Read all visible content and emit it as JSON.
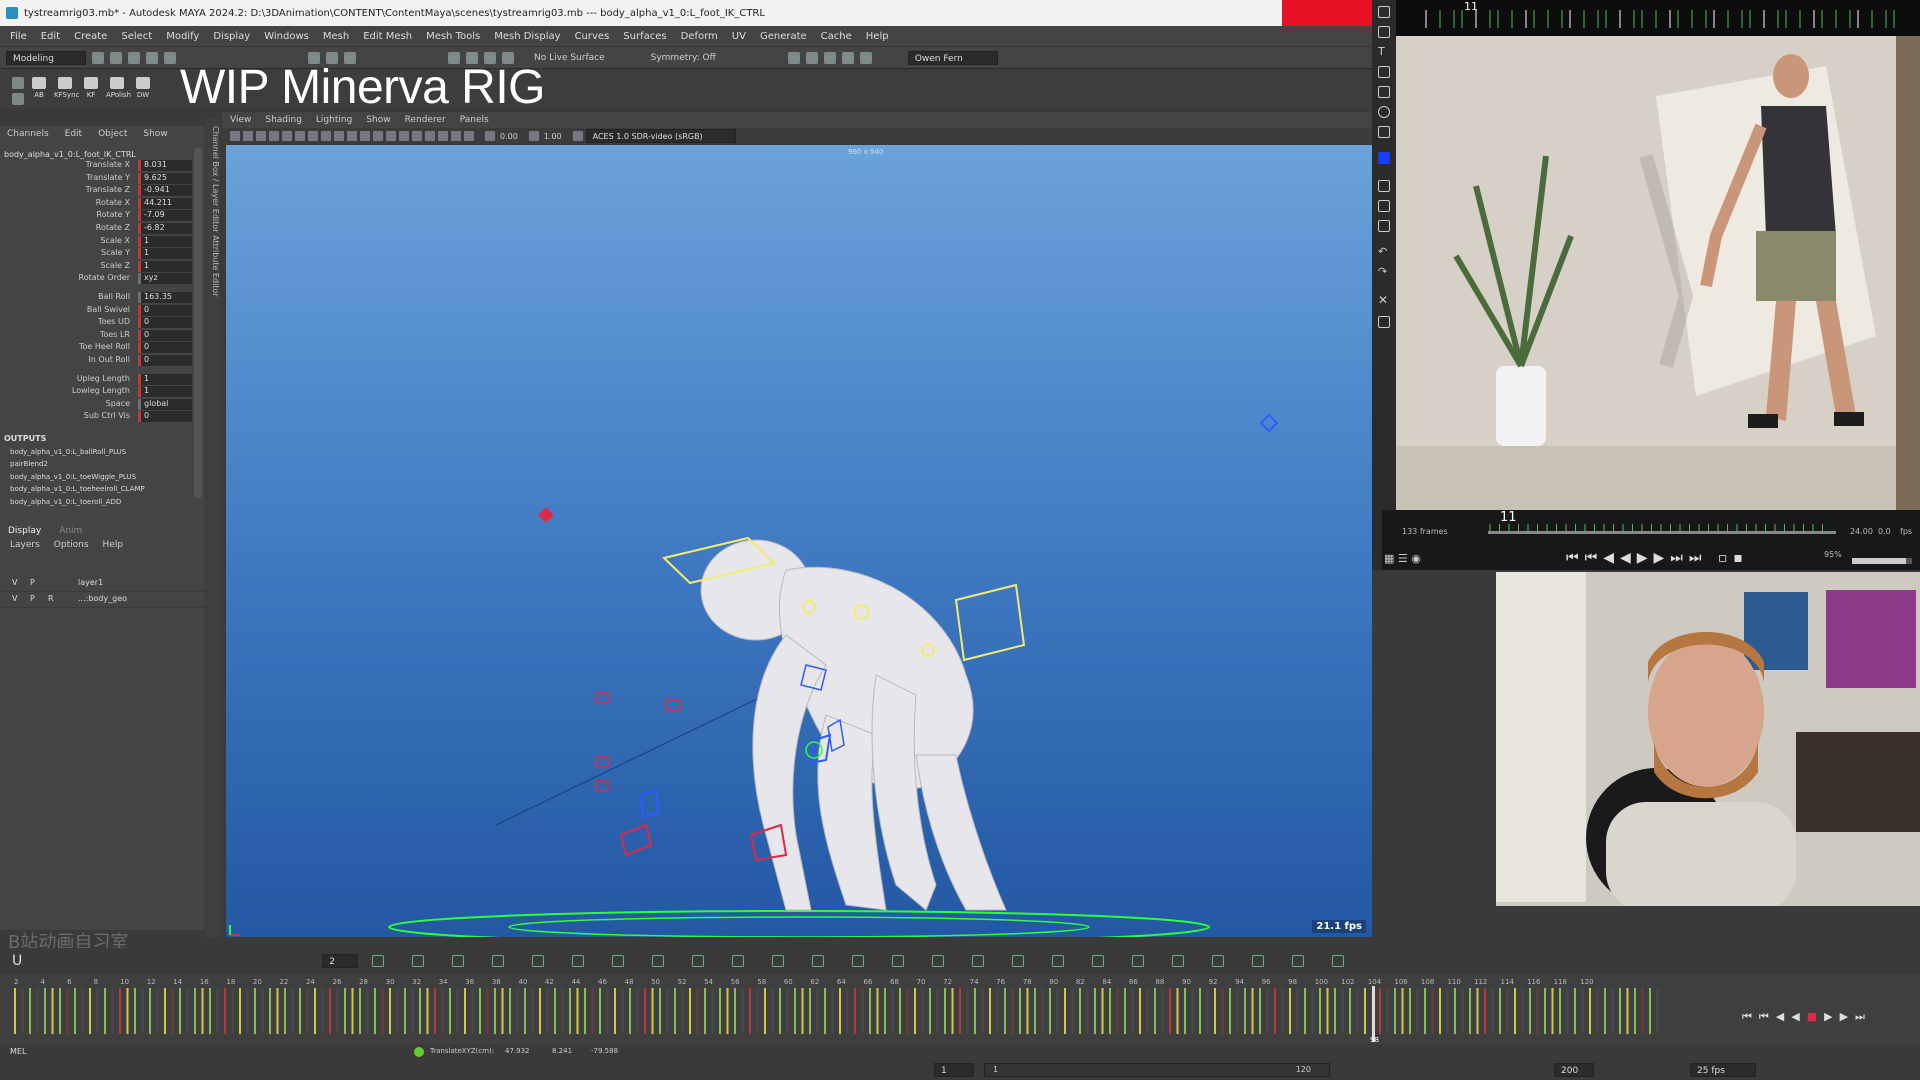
{
  "window": {
    "title": "tystreamrig03.mb* - Autodesk MAYA 2024.2: D:\\3DAnimation\\CONTENT\\ContentMaya\\scenes\\tystreamrig03.mb  ---  body_alpha_v1_0:L_foot_IK_CTRL"
  },
  "menubar": [
    "File",
    "Edit",
    "Create",
    "Select",
    "Modify",
    "Display",
    "Windows",
    "Mesh",
    "Edit Mesh",
    "Mesh Tools",
    "Mesh Display",
    "Curves",
    "Surfaces",
    "Deform",
    "UV",
    "Generate",
    "Cache",
    "Help"
  ],
  "statusline": {
    "workspace": "Modeling",
    "live_surface": "No Live Surface",
    "symmetry": "Symmetry: Off",
    "user": "Owen Fern"
  },
  "shelf": {
    "buttons": [
      "AB",
      "KFSync",
      "KF",
      "APolish",
      "DW"
    ]
  },
  "overlay_title": "WIP Minerva RIG",
  "channelbox": {
    "menu": [
      "Channels",
      "Edit",
      "Object",
      "Show"
    ],
    "node": "body_alpha_v1_0:L_foot_IK_CTRL",
    "attributes": [
      {
        "label": "Translate X",
        "value": "8.031",
        "key": "red"
      },
      {
        "label": "Translate Y",
        "value": "9.625",
        "key": "red"
      },
      {
        "label": "Translate Z",
        "value": "-0.941",
        "key": "red"
      },
      {
        "label": "Rotate X",
        "value": "44.211",
        "key": "red"
      },
      {
        "label": "Rotate Y",
        "value": "-7.09",
        "key": "red"
      },
      {
        "label": "Rotate Z",
        "value": "-6.82",
        "key": "red"
      },
      {
        "label": "Scale X",
        "value": "1",
        "key": "red"
      },
      {
        "label": "Scale Y",
        "value": "1",
        "key": "red"
      },
      {
        "label": "Scale Z",
        "value": "1",
        "key": "red"
      },
      {
        "label": "Rotate Order",
        "value": "xyz",
        "key": "grey"
      },
      {
        "label": "Ball Roll",
        "value": "163.35",
        "key": "grey"
      },
      {
        "label": "Ball Swivel",
        "value": "0",
        "key": "red"
      },
      {
        "label": "Toes UD",
        "value": "0",
        "key": "red"
      },
      {
        "label": "Toes LR",
        "value": "0",
        "key": "red"
      },
      {
        "label": "Toe Heel Roll",
        "value": "0",
        "key": "red"
      },
      {
        "label": "In Out Roll",
        "value": "0",
        "key": "red"
      },
      {
        "label": "Upleg Length",
        "value": "1",
        "key": "red"
      },
      {
        "label": "Lowleg Length",
        "value": "1",
        "key": "red"
      },
      {
        "label": "Space",
        "value": "global",
        "key": "grey"
      },
      {
        "label": "Sub Ctrl Vis",
        "value": "0",
        "key": "red"
      }
    ],
    "outputs_heading": "OUTPUTS",
    "outputs": [
      "body_alpha_v1_0:L_ballRoll_PLUS",
      "pairBlend2",
      "body_alpha_v1_0:L_toeWiggle_PLUS",
      "body_alpha_v1_0:L_toeheelroll_CLAMP",
      "body_alpha_v1_0:L_toeroll_ADD"
    ]
  },
  "side_tabs": "Channel Box / Layer Editor    Attribute Editor",
  "layers": {
    "tabs": [
      "Display",
      "Anim"
    ],
    "menu": [
      "Layers",
      "Options",
      "Help"
    ],
    "rows": [
      {
        "v": "V",
        "p": "P",
        "r": "",
        "name": "layer1"
      },
      {
        "v": "V",
        "p": "P",
        "r": "R",
        "name": "...:body_geo"
      }
    ],
    "watermark": "B站动画自习室"
  },
  "viewport": {
    "menu": [
      "View",
      "Shading",
      "Lighting",
      "Show",
      "Renderer",
      "Panels"
    ],
    "exposure": "0.00",
    "gamma": "1.00",
    "colorspace": "ACES 1.0 SDR-video (sRGB)",
    "resolution": "960 x 540",
    "fps": "21.1 fps"
  },
  "reference": {
    "frame_top": "11",
    "frame_current": "11",
    "frames_total": "133 frames",
    "rate": "24.00",
    "zoom": "0.0",
    "fps_label": "fps",
    "volume": "95%"
  },
  "timeline": {
    "labels": [
      "2",
      "4",
      "6",
      "8",
      "10",
      "12",
      "14",
      "16",
      "18",
      "20",
      "22",
      "24",
      "26",
      "28",
      "30",
      "32",
      "34",
      "36",
      "38",
      "40",
      "42",
      "44",
      "46",
      "48",
      "50",
      "52",
      "54",
      "56",
      "58",
      "60",
      "62",
      "64",
      "66",
      "68",
      "70",
      "72",
      "74",
      "76",
      "78",
      "80",
      "82",
      "84",
      "86",
      "88",
      "90",
      "92",
      "94",
      "96",
      "98",
      "100",
      "102",
      "104",
      "106",
      "108",
      "110",
      "112",
      "114",
      "116",
      "118",
      "120"
    ],
    "current_frame": "98",
    "frame_field": "2"
  },
  "helpline": {
    "mode": "MEL",
    "readout_label": "TranslateXYZ(cm):",
    "tx": "47.932",
    "ty": "8.241",
    "tz": "-79.588"
  },
  "range": {
    "start": "1",
    "inner_start": "1",
    "inner_end": "120",
    "end": "200",
    "fps": "25 fps"
  },
  "colors": {
    "key_red": "#c03a3a",
    "viewport_top": "#6aa3d9",
    "viewport_bottom": "#2358a3",
    "ctrl_yellow": "#f4ea6e",
    "ctrl_blue": "#2e5bff",
    "ctrl_red": "#e0284a",
    "ground_green": "#2cff3a"
  }
}
